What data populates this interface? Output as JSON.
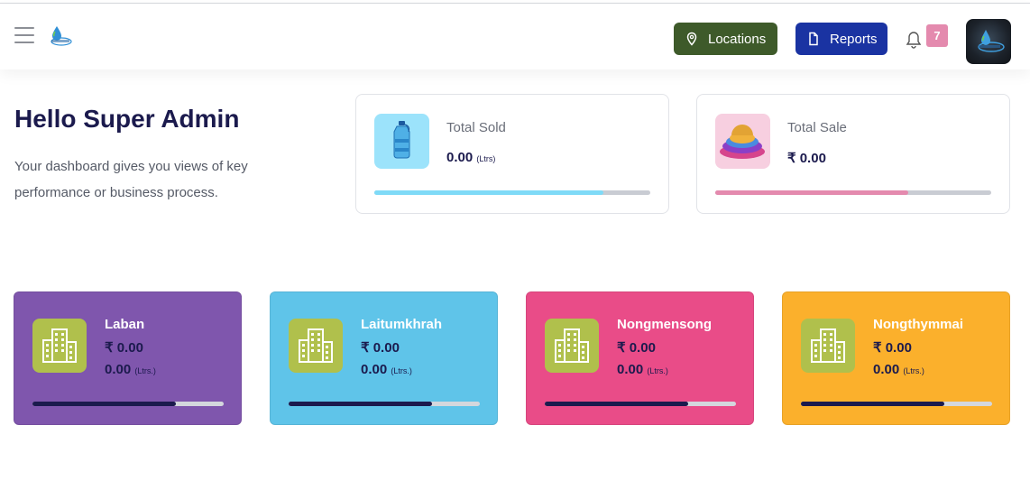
{
  "header": {
    "locations_label": "Locations",
    "reports_label": "Reports",
    "notification_count": "7"
  },
  "greeting": {
    "title": "Hello Super Admin",
    "description": "Your dashboard gives you views of key performance or business process."
  },
  "stats": [
    {
      "label": "Total Sold",
      "value": "0.00",
      "unit": "(Ltrs)",
      "progress": 0.83,
      "color": "#7fdaf7"
    },
    {
      "label": "Total Sale",
      "value": "₹ 0.00",
      "unit": "",
      "progress": 0.7,
      "color": "#e48aae"
    }
  ],
  "locations": [
    {
      "name": "Laban",
      "amount": "₹ 0.00",
      "litres": "0.00",
      "unit": "(Ltrs.)",
      "progress": 0.75,
      "color": "#7f56ad"
    },
    {
      "name": "Laitumkhrah",
      "amount": "₹ 0.00",
      "litres": "0.00",
      "unit": "(Ltrs.)",
      "progress": 0.75,
      "color": "#5fc4e9"
    },
    {
      "name": "Nongmensong",
      "amount": "₹ 0.00",
      "litres": "0.00",
      "unit": "(Ltrs.)",
      "progress": 0.75,
      "color": "#e94c88"
    },
    {
      "name": "Nongthymmai",
      "amount": "₹ 0.00",
      "litres": "0.00",
      "unit": "(Ltrs.)",
      "progress": 0.75,
      "color": "#fbb02c"
    }
  ],
  "icons": {
    "menu": "hamburger-icon",
    "logo": "water-drop-logo",
    "locations": "map-pin-icon",
    "reports": "document-icon",
    "notifications": "bell-icon",
    "total_sold": "water-bottle-icon",
    "total_sale": "coin-stack-icon",
    "location_card": "building-icon"
  }
}
